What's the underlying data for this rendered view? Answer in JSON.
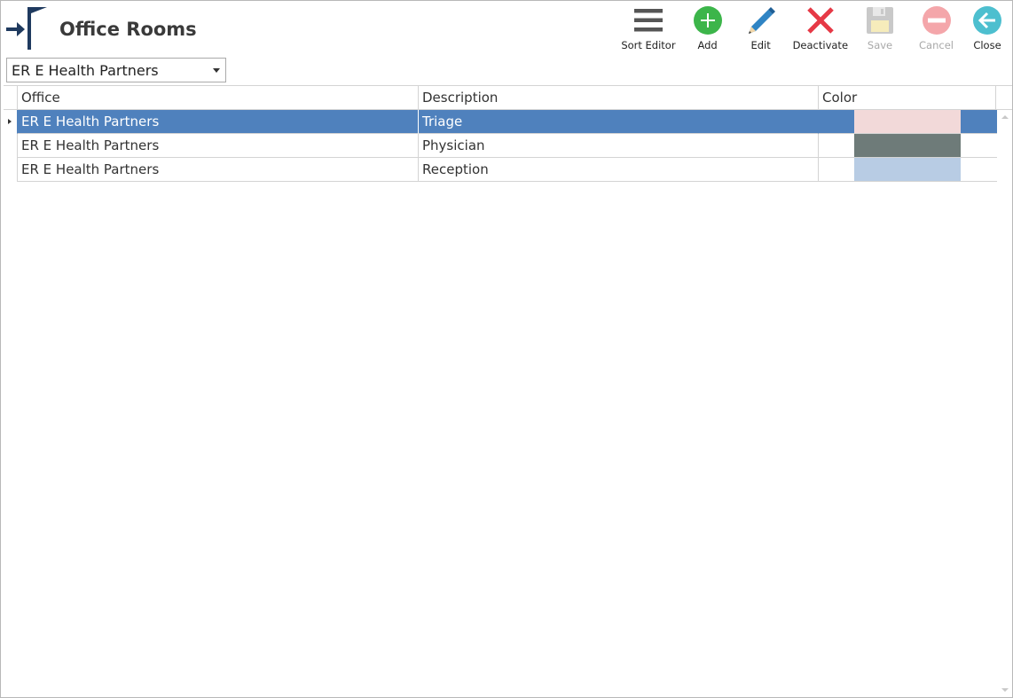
{
  "window": {
    "title": "Office Rooms"
  },
  "toolbar": {
    "sort_editor": "Sort Editor",
    "add": "Add",
    "edit": "Edit",
    "deactivate": "Deactivate",
    "save": "Save",
    "cancel": "Cancel",
    "close": "Close"
  },
  "office_select": {
    "value": "ER E Health Partners"
  },
  "grid": {
    "columns": [
      "Office",
      "Description",
      "Color"
    ],
    "rows": [
      {
        "office": "ER E Health Partners",
        "description": "Triage",
        "color": "#f2d9d9",
        "selected": true
      },
      {
        "office": "ER E Health Partners",
        "description": "Physician",
        "color": "#6e7b79",
        "selected": false
      },
      {
        "office": "ER E Health Partners",
        "description": "Reception",
        "color": "#b8cce4",
        "selected": false
      }
    ]
  },
  "colors": {
    "selection": "#4f81bd",
    "add_icon": "#3cb54a",
    "edit_icon": "#2f84c4",
    "deactivate_icon": "#e63946",
    "cancel_icon": "#f4a6aa",
    "close_icon": "#4dbfcf",
    "brand": "#1f3a5f"
  },
  "icons": {
    "sort_editor": "hamburger-icon",
    "add": "plus-circle-icon",
    "edit": "pencil-icon",
    "deactivate": "x-icon",
    "save": "floppy-disk-icon",
    "cancel": "minus-circle-icon",
    "close": "back-arrow-circle-icon"
  }
}
